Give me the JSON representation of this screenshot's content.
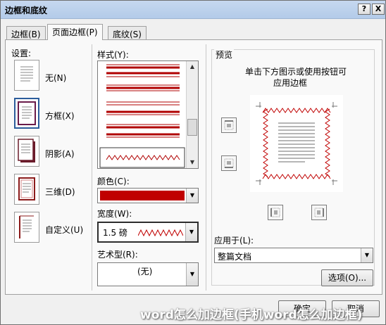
{
  "window": {
    "title": "边框和底纹",
    "help_button": "?",
    "close_button": "X"
  },
  "tabs": [
    {
      "label": "边框(B)",
      "active": false
    },
    {
      "label": "页面边框(P)",
      "active": true
    },
    {
      "label": "底纹(S)",
      "active": false
    }
  ],
  "settings": {
    "heading": "设置:",
    "items": [
      {
        "label": "无(N)"
      },
      {
        "label": "方框(X)"
      },
      {
        "label": "阴影(A)"
      },
      {
        "label": "三维(D)"
      },
      {
        "label": "自定义(U)"
      }
    ]
  },
  "style": {
    "heading": "样式(Y):",
    "line_color": "#b00000"
  },
  "color": {
    "heading": "颜色(C):",
    "value": "#c00000"
  },
  "width": {
    "heading": "宽度(W):",
    "value": "1.5 磅"
  },
  "art": {
    "heading": "艺术型(R):",
    "value": "(无)"
  },
  "preview": {
    "heading": "预览",
    "hint_line1": "单击下方图示或使用按钮可",
    "hint_line2": "应用边框"
  },
  "apply_to": {
    "heading": "应用于(L):",
    "value": "整篇文档"
  },
  "buttons": {
    "options": "选项(O)...",
    "ok": "确定",
    "cancel": "取消"
  },
  "watermark": "word怎么加边框(手机word怎么加边框)"
}
